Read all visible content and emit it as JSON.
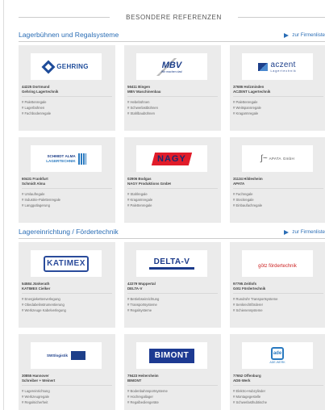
{
  "header": {
    "title": "BESONDERE REFERENZEN"
  },
  "sections": [
    {
      "title": "Lagerbühnen und Regalsysteme",
      "link": "zur Firmenliste",
      "cards": [
        {
          "logo": "GEHRING",
          "city": "44225 Dortmund",
          "name": "Gehring Lagertechnik",
          "tags": [
            "# Palettenregale",
            "# Lagerbühnen",
            "# Fachbodenregale"
          ]
        },
        {
          "logo": "MBV",
          "logo_sub": "Wir machen das!",
          "city": "56411 Bingen",
          "name": "MBV Maschinenbau",
          "tags": [
            "# Hebebühnen",
            "# Schwerlastbühnen",
            "# Stahlbaubühnen"
          ]
        },
        {
          "logo": "aczent",
          "logo_sub": "Lagertechnik",
          "city": "37686 Holzminden",
          "name": "ACZENT Lagertechnik",
          "tags": [
            "# Palettenregale",
            "# Weitspannregale",
            "# Kragarmregale"
          ]
        },
        {
          "logo": "SCHMIDT ALMA",
          "logo_sub": "LAGERTECHNIK",
          "city": "60431 Frankfurt",
          "name": "Schmidt Alma",
          "tags": [
            "# Umlaufregale",
            "# Industrie-Palettenregale",
            "# Langgutlagerung"
          ]
        },
        {
          "logo": "NAGY",
          "city": "02906 Bodgas",
          "name": "NAGY Produktions GmbH",
          "tags": [
            "# Stahlregale",
            "# Kragarmregale",
            "# Palettenregale"
          ]
        },
        {
          "logo": "APATA",
          "logo_sub": "GmbH",
          "city": "31134 Hildesheim",
          "name": "APATA",
          "tags": [
            "# Fachregale",
            "# Steckregale",
            "# Einbaufachregale"
          ]
        }
      ]
    },
    {
      "title": "Lagereinrichtung / Fördertechnik",
      "link": "zur Firmenliste",
      "cards": [
        {
          "logo": "KATIMEX",
          "city": "54584 Jünkerath",
          "name": "KATIMEX Cielker",
          "tags": [
            "# Energiekettenverlegung",
            "# Obedabelinstrumentierung",
            "# Werkzeuge Kabelverlegung"
          ]
        },
        {
          "logo": "DELTA-V",
          "city": "42279 Wuppertal",
          "name": "DELTA-V",
          "tags": [
            "# Betriebseinrichtung",
            "# Transportsysteme",
            "# Regalsysteme"
          ]
        },
        {
          "logo": "götz fördertechnik",
          "city": "97795 Zeitlofs",
          "name": "Götz Fördertechnik",
          "tags": [
            "# Rundrohr Transportsysteme",
            "# Senkrechtförderer",
            "# Schienensysteme"
          ]
        },
        {
          "logo": "SWSlogistik",
          "city": "30855 Hannover",
          "name": "Schreiber + Weinert",
          "tags": [
            "# Lagereinrichtung",
            "# Werkzeugregale",
            "# Regalsicherheit"
          ]
        },
        {
          "logo": "BIMONT",
          "city": "79423 Heitersheim",
          "name": "BIMONT",
          "tags": [
            "# Bodenbahnsportsysteme",
            "# Hochregallager",
            "# Regalbediengeräte"
          ]
        },
        {
          "logo": "ade",
          "logo_sub": "ADE-WERK",
          "city": "77652 Offenburg",
          "name": "ADE-Werk",
          "tags": [
            "# Elektro-Hubzylinder",
            "# Montagegestelle",
            "# Schwerlasthubtische"
          ]
        }
      ]
    }
  ],
  "colors": {
    "accent": "#2a6db5",
    "card_bg": "#ebebeb"
  }
}
